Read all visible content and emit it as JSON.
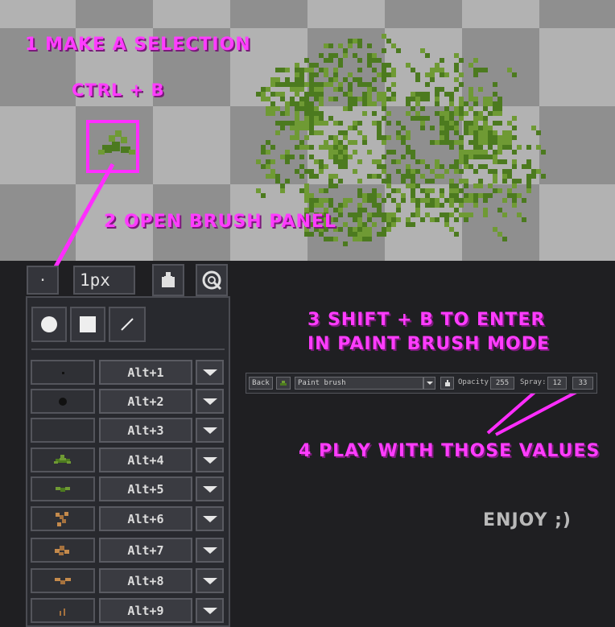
{
  "annotations": {
    "step1": "1 MAKE A SELECTION",
    "shortcut1": "CTRL + B",
    "step2": "2 OPEN BRUSH PANEL",
    "step3_line1": "3 SHIFT + B TO ENTER",
    "step3_line2": "IN PAINT BRUSH MODE",
    "step4": "4 PLAY WITH THOSE VALUES",
    "enjoy": "ENJOY ;)"
  },
  "brush_toolbar": {
    "dot_button": "·",
    "size_value": "1px",
    "icons": [
      "bottle-icon",
      "spray-target-icon"
    ]
  },
  "brush_panel": {
    "shape_buttons": [
      "circle-icon",
      "square-icon",
      "line-icon"
    ],
    "rows": [
      {
        "icon": "small-dot-icon",
        "shortcut": "Alt+1"
      },
      {
        "icon": "big-dot-icon",
        "shortcut": "Alt+2"
      },
      {
        "icon": "empty-icon",
        "shortcut": "Alt+3"
      },
      {
        "icon": "green-leaf-icon",
        "shortcut": "Alt+4"
      },
      {
        "icon": "small-leaf-icon",
        "shortcut": "Alt+5"
      },
      {
        "icon": "brown-leaves-icon",
        "shortcut": "Alt+6"
      },
      {
        "icon": "brown-leaf-cluster-icon",
        "shortcut": "Alt+7"
      },
      {
        "icon": "brown-wings-icon",
        "shortcut": "Alt+8"
      },
      {
        "icon": "grass-icon",
        "shortcut": "Alt+9"
      }
    ]
  },
  "paint_toolbar": {
    "back_label": "Back",
    "brush_select": "Paint brush",
    "opacity_label": "Opacity:",
    "opacity_value": "255",
    "spray_label": "Spray:",
    "spray_value": "12",
    "spray_value2": "33"
  },
  "colors": {
    "annotation": "#ff3cff",
    "leaf_dark": "#4c7a1f",
    "leaf_light": "#6f9a34",
    "checker_light": "#b2b2b2",
    "checker_dark": "#8f8f8f"
  }
}
